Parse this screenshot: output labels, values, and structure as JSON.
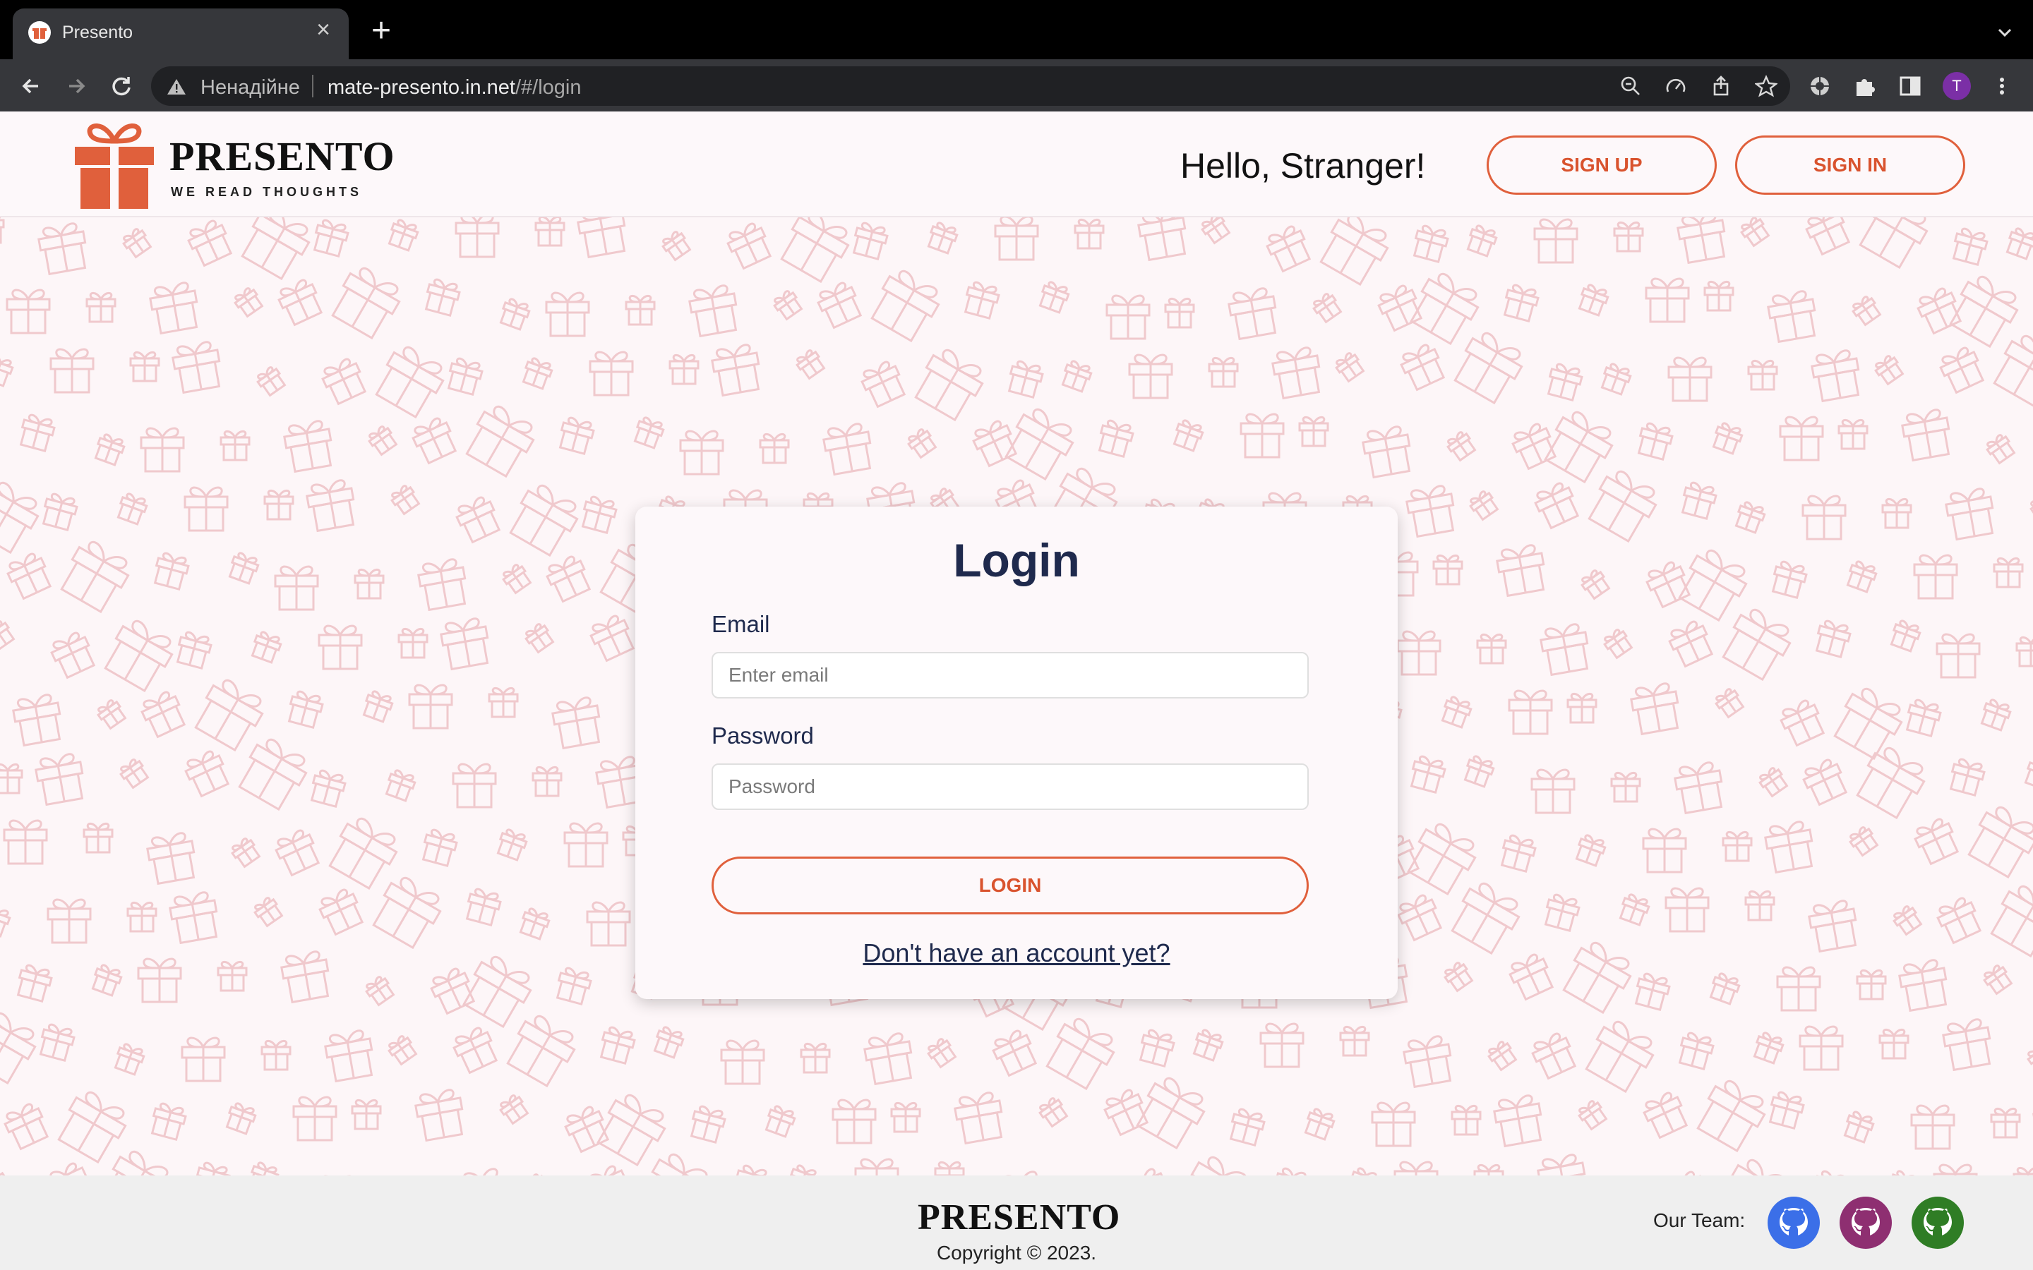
{
  "browser": {
    "tab_title": "Presento",
    "tab_close": "×",
    "new_tab": "+",
    "security_label": "Ненадійне",
    "url_host": "mate-presento.in.net",
    "url_path": "/#/login",
    "profile_initial": "T"
  },
  "header": {
    "logo_text": "PRESENTO",
    "tagline": "WE READ THOUGHTS",
    "greeting": "Hello, Stranger!",
    "signup_label": "SIGN UP",
    "signin_label": "SIGN IN"
  },
  "login": {
    "title": "Login",
    "email_label": "Email",
    "email_placeholder": "Enter email",
    "password_label": "Password",
    "password_placeholder": "Password",
    "submit_label": "LOGIN",
    "signup_link": "Don't have an account yet?"
  },
  "footer": {
    "logo_text": "PRESENTO",
    "copyright": "Copyright © 2023.",
    "team_label": "Our Team:"
  },
  "colors": {
    "accent": "#e0603c",
    "text_dark": "#1f2a4d",
    "pattern": "#f0c9cd",
    "github_1": "#3b6fe8",
    "github_2": "#8e2f71",
    "github_3": "#2f7d25"
  }
}
